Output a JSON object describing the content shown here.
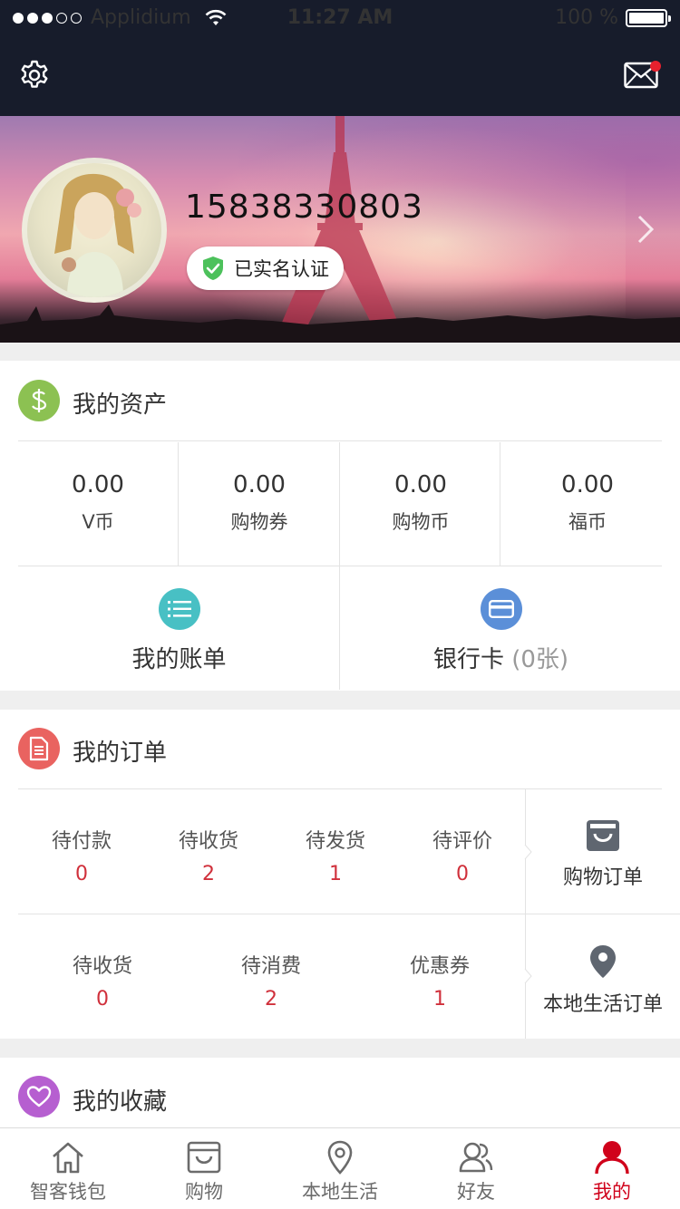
{
  "status_bar": {
    "carrier": "Applidium",
    "time": "11:27 AM",
    "battery": "100 %"
  },
  "header": {
    "settings_icon": "gear-icon",
    "message_icon": "envelope-icon",
    "has_unread": true
  },
  "profile": {
    "phone": "15838330803",
    "verified_label": "已实名认证"
  },
  "assets": {
    "title": "我的资产",
    "items": [
      {
        "value": "0.00",
        "label": "V币"
      },
      {
        "value": "0.00",
        "label": "购物券"
      },
      {
        "value": "0.00",
        "label": "购物币"
      },
      {
        "value": "0.00",
        "label": "福币"
      }
    ],
    "bill_label": "我的账单",
    "card_label": "银行卡",
    "card_count": "(0张)"
  },
  "orders": {
    "title": "我的订单",
    "shopping_row": [
      {
        "label": "待付款",
        "count": "0"
      },
      {
        "label": "待收货",
        "count": "2"
      },
      {
        "label": "待发货",
        "count": "1"
      },
      {
        "label": "待评价",
        "count": "0"
      }
    ],
    "shopping_orders_label": "购物订单",
    "local_row": [
      {
        "label": "待收货",
        "count": "0"
      },
      {
        "label": "待消费",
        "count": "2"
      },
      {
        "label": "优惠券",
        "count": "1"
      }
    ],
    "local_orders_label": "本地生活订单"
  },
  "favorites": {
    "title": "我的收藏"
  },
  "tabs": [
    {
      "label": "智客钱包",
      "icon": "home-icon"
    },
    {
      "label": "购物",
      "icon": "shopping-bag-icon"
    },
    {
      "label": "本地生活",
      "icon": "location-pin-icon"
    },
    {
      "label": "好友",
      "icon": "friends-icon"
    },
    {
      "label": "我的",
      "icon": "profile-icon",
      "active": true
    }
  ],
  "colors": {
    "topbar": "#171c2b",
    "accent_red": "#d0021b",
    "count_red": "#d0303b",
    "asset_icon": "#8cc152",
    "bill_icon": "#48c0c4",
    "card_icon": "#5b8fd8",
    "order_icon": "#e96360",
    "favorite_icon": "#b65fd0"
  }
}
